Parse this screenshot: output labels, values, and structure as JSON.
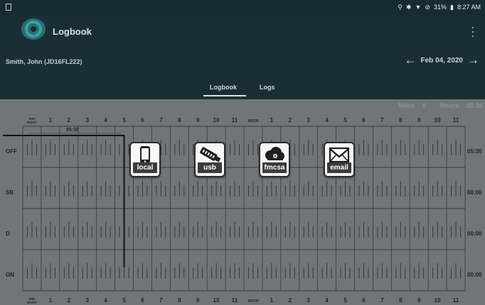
{
  "status_bar": {
    "battery": "31%",
    "time": "8:27 AM"
  },
  "app": {
    "title": "Logbook"
  },
  "driver": {
    "name": "Smith, John (JD16FL222)"
  },
  "date_nav": {
    "date": "Feb 04, 2020"
  },
  "tabs": [
    {
      "label": "Logbook",
      "selected": true
    },
    {
      "label": "Logs",
      "selected": false
    }
  ],
  "summary": {
    "miles_label": "Miles",
    "miles_value": "0",
    "hours_label": "Hours",
    "hours_value": "05:30"
  },
  "grid": {
    "top_hours": [
      "MID NIGHT",
      "1",
      "2",
      "3",
      "4",
      "5",
      "6",
      "7",
      "8",
      "9",
      "10",
      "11",
      "NOON",
      "1",
      "2",
      "3",
      "4",
      "5",
      "6",
      "7",
      "8",
      "9",
      "10",
      "11"
    ],
    "bottom_hours": [
      "MID NIGHT",
      "1",
      "2",
      "3",
      "4",
      "5",
      "6",
      "7",
      "8",
      "9",
      "10",
      "11",
      "NOON",
      "1",
      "2",
      "3",
      "4",
      "5",
      "6",
      "7",
      "8",
      "9",
      "10",
      "11"
    ],
    "rows": [
      {
        "label": "OFF",
        "total": "05:30"
      },
      {
        "label": "SB",
        "total": "00:00"
      },
      {
        "label": "D",
        "total": "00:00"
      },
      {
        "label": "ON",
        "total": "00:00"
      }
    ],
    "duration_label": "05:30"
  },
  "export_buttons": [
    {
      "label": "local",
      "icon": "phone-icon"
    },
    {
      "label": "usb",
      "icon": "usb-drive-icon"
    },
    {
      "label": "fmcsa",
      "icon": "cloud-icon"
    },
    {
      "label": "email",
      "icon": "envelope-icon"
    }
  ],
  "colors": {
    "header_bg": "#1a2e35",
    "grid_bg": "#6f7677",
    "grid_line": "#353a3b",
    "log_line": "#111111"
  }
}
